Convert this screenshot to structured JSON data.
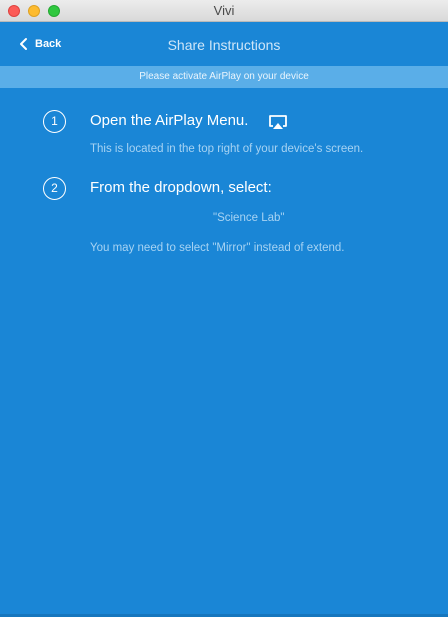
{
  "window": {
    "title": "Vivi"
  },
  "navbar": {
    "back_label": "Back",
    "title": "Share Instructions"
  },
  "banner": {
    "text": "Please activate AirPlay on your device"
  },
  "steps": [
    {
      "number": "1",
      "title": "Open the AirPlay Menu.",
      "icon": "airplay-icon",
      "description": "This is located in the top right of your device's screen."
    },
    {
      "number": "2",
      "title": "From the dropdown, select:",
      "device_name": "\"Science Lab\"",
      "note": "You may need to select \"Mirror\" instead of extend."
    }
  ],
  "colors": {
    "background": "#1a86d6",
    "banner": "#5aaee8",
    "text_primary": "#ffffff",
    "text_secondary": "#a7d3f3"
  }
}
